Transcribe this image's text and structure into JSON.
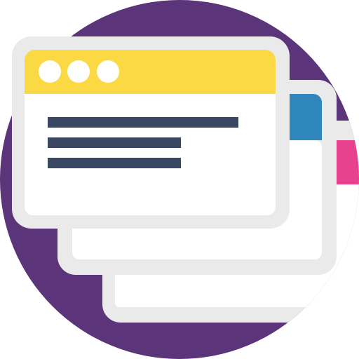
{
  "illustration": {
    "subject": "stacked-browser-windows",
    "icon_name": "multiple-windows-icon",
    "window_count": 3
  },
  "colors": {
    "background_circle": "#5B3479",
    "window_frame": "#EAEAEA",
    "window_body": "#FFFFFF",
    "front_titlebar": "#FBD944",
    "middle_titlebar": "#2E86BA",
    "back_titlebar": "#E8428E",
    "titlebar_dots": "#FFFFFF",
    "text_lines": "#3A4763"
  }
}
